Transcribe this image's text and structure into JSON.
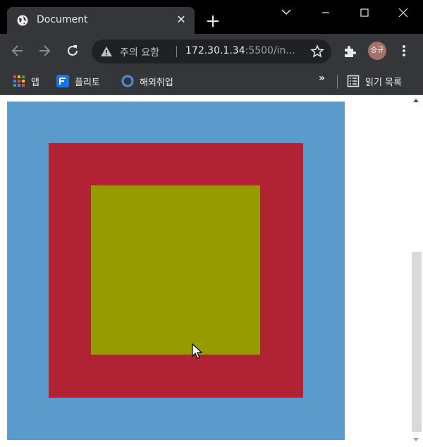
{
  "tab": {
    "title": "Document",
    "close": "✕"
  },
  "omnibox": {
    "security_text": "주의 요함",
    "url_host": "172.30.1.34",
    "url_rest": ":5500/in..."
  },
  "profile": {
    "avatar_text": "승규"
  },
  "bookmarks": {
    "items": [
      {
        "label": "앱"
      },
      {
        "label": "플리토"
      },
      {
        "label": "해외취업"
      }
    ],
    "more": "»",
    "reading_list": "읽기 목록"
  },
  "page": {
    "colors": {
      "outer": "#5b9bcb",
      "middle": "#b02234",
      "inner": "#959c00"
    }
  }
}
